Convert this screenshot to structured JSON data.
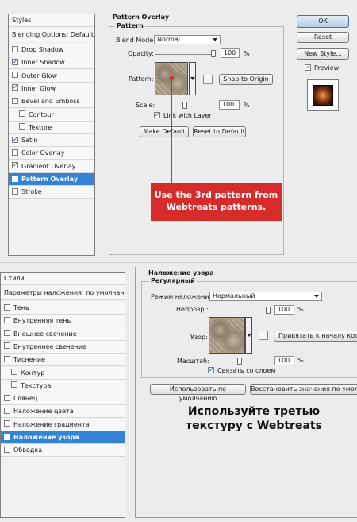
{
  "en": {
    "styles_header": "Styles",
    "blending_default": "Blending Options: Default",
    "styles": [
      {
        "label": "Drop Shadow",
        "checked": false,
        "indent": false,
        "selected": false
      },
      {
        "label": "Inner Shadow",
        "checked": true,
        "indent": false,
        "selected": false
      },
      {
        "label": "Outer Glow",
        "checked": false,
        "indent": false,
        "selected": false
      },
      {
        "label": "Inner Glow",
        "checked": true,
        "indent": false,
        "selected": false
      },
      {
        "label": "Bevel and Emboss",
        "checked": false,
        "indent": false,
        "selected": false
      },
      {
        "label": "Contour",
        "checked": false,
        "indent": true,
        "selected": false
      },
      {
        "label": "Texture",
        "checked": false,
        "indent": true,
        "selected": false
      },
      {
        "label": "Satin",
        "checked": true,
        "indent": false,
        "selected": false
      },
      {
        "label": "Color Overlay",
        "checked": false,
        "indent": false,
        "selected": false
      },
      {
        "label": "Gradient Overlay",
        "checked": true,
        "indent": false,
        "selected": false
      },
      {
        "label": "Pattern Overlay",
        "checked": true,
        "indent": false,
        "selected": true
      },
      {
        "label": "Stroke",
        "checked": false,
        "indent": false,
        "selected": false
      }
    ],
    "section_title": "Pattern Overlay",
    "group_title": "Pattern",
    "blend_mode_label": "Blend Mode:",
    "blend_mode_value": "Normal",
    "opacity_label": "Opacity:",
    "opacity_value": "100",
    "percent": "%",
    "pattern_label": "Pattern:",
    "snap_button": "Snap to Origin",
    "scale_label": "Scale:",
    "scale_value": "100",
    "link_label": "Link with Layer",
    "make_default": "Make Default",
    "reset_default": "Reset to Default",
    "ok": "OK",
    "reset": "Reset",
    "new_style": "New Style...",
    "preview_label": "Preview",
    "callout": "Use the 3rd pattern from Webtreats patterns."
  },
  "ru": {
    "styles_header": "Стили",
    "blending_default": "Параметры наложения: по умолчанию",
    "styles": [
      {
        "label": "Тень",
        "checked": false,
        "indent": false,
        "selected": false
      },
      {
        "label": "Внутренняя тень",
        "checked": false,
        "indent": false,
        "selected": false
      },
      {
        "label": "Внешнее свечение",
        "checked": false,
        "indent": false,
        "selected": false
      },
      {
        "label": "Внутреннее свечение",
        "checked": false,
        "indent": false,
        "selected": false
      },
      {
        "label": "Тиснение",
        "checked": false,
        "indent": false,
        "selected": false
      },
      {
        "label": "Контур",
        "checked": false,
        "indent": true,
        "selected": false
      },
      {
        "label": "Текстура",
        "checked": false,
        "indent": true,
        "selected": false
      },
      {
        "label": "Глянец",
        "checked": false,
        "indent": false,
        "selected": false
      },
      {
        "label": "Наложение цвета",
        "checked": false,
        "indent": false,
        "selected": false
      },
      {
        "label": "Наложение градиента",
        "checked": false,
        "indent": false,
        "selected": false
      },
      {
        "label": "Наложение узора",
        "checked": true,
        "indent": false,
        "selected": true
      },
      {
        "label": "Обводка",
        "checked": false,
        "indent": false,
        "selected": false
      }
    ],
    "section_title": "Наложение узора",
    "group_title": "Регулярный",
    "blend_mode_label": "Режим наложения:",
    "blend_mode_value": "Нормальный",
    "opacity_label": "Непрозр.:",
    "opacity_value": "100",
    "percent": "%",
    "pattern_label": "Узор:",
    "snap_button": "Привязать к началу коорд",
    "scale_label": "Масштаб:",
    "scale_value": "100",
    "link_label": "Связать со слоем",
    "make_default": "Использовать по умолчанию",
    "reset_default": "Восстановить значения по умолча",
    "caption_line1": "Используйте третью",
    "caption_line2": "текстуру с Webtreats"
  },
  "colors": {
    "selection": "#3484d6",
    "callout": "#d52b2b"
  }
}
